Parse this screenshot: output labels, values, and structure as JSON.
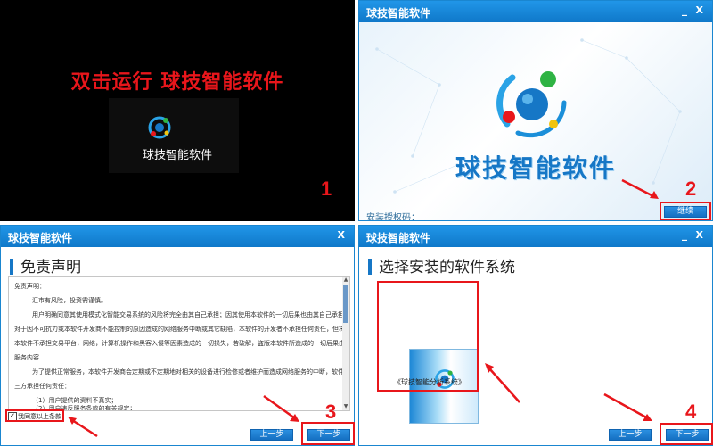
{
  "q1": {
    "title": "双击运行 球技智能软件",
    "icon_label": "球技智能软件",
    "step": "1"
  },
  "app": {
    "title": "球技智能软件",
    "min_icon": "_",
    "close_icon": "X"
  },
  "q2": {
    "brand": "球技智能软件",
    "auth_label": "安装授权码：",
    "continue_label": "继续",
    "step": "2"
  },
  "q3": {
    "heading": "免责声明",
    "lines": [
      "免责声明：",
      "汇市有风险，投资需谨慎。",
      "用户明确同意其使用模式化智能交易系统的风险将完全由其自己承担；因其使用本软件的一切后果也由其自己承担，本软件开",
      "对于因不可抗力或本软件开发商不能控制的原因造成的网络服务中断或其它缺陷，本软件的开发者不承担任何责任，但将尽力",
      "本软件不承担交易平台，网络，计算机操作和黑客入侵等因素造成的一切损失，若破解，盗版本软件所造成的一切后果由用户自己承",
      "服务内容",
      "为了提供正常服务，本软件开发商会定期或不定期地对相关的设备进行检修或者维护而造成网络服务的中断，软件开发商尽力",
      "三方承担任何责任：",
      "（1）用户提供的资料不真实；",
      "（2）用户违反服务条款的有关规定；"
    ],
    "agree_label": "我同意以上条款",
    "prev_label": "上一步",
    "next_label": "下一步",
    "step": "3"
  },
  "q4": {
    "heading": "选择安装的软件系统",
    "product_caption": "《球技智能分析系统》",
    "prev_label": "上一步",
    "next_label": "下一步",
    "step": "4"
  },
  "colors": {
    "accent": "#1677c6",
    "annotation": "#e8161b"
  }
}
